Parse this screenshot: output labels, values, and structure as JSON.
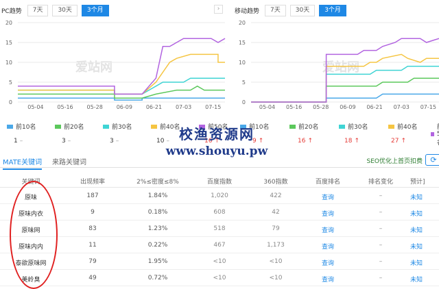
{
  "pc": {
    "title": "PC趋势",
    "tabs": [
      "7天",
      "30天",
      "3个月"
    ],
    "active": 2,
    "watermark": "爱站网"
  },
  "mobile": {
    "title": "移动趋势",
    "tabs": [
      "7天",
      "30天",
      "3个月"
    ],
    "active": 2,
    "watermark": "爱站网"
  },
  "colors": {
    "top10": "#4aa8e8",
    "top20": "#5cc85c",
    "top30": "#3fd4d4",
    "top40": "#f5c542",
    "top50": "#b264e0",
    "accent": "#1e88e5",
    "red": "#e53935"
  },
  "chart_data": [
    {
      "type": "line",
      "title": "PC趋势",
      "x": [
        "05-04",
        "05-16",
        "05-28",
        "06-09",
        "06-21",
        "07-03",
        "07-15"
      ],
      "ylim": [
        0,
        20
      ],
      "yticks": [
        0,
        5,
        10,
        15,
        20
      ],
      "grid": true,
      "series": [
        {
          "name": "前10名",
          "color": "#4aa8e8",
          "points": [
            [
              0,
              1
            ],
            [
              14,
              1
            ],
            [
              14,
              0.5
            ],
            [
              18,
              0.5
            ],
            [
              18,
              1
            ],
            [
              30,
              1
            ]
          ]
        },
        {
          "name": "前20名",
          "color": "#5cc85c",
          "points": [
            [
              0,
              2
            ],
            [
              14,
              2
            ],
            [
              14,
              1
            ],
            [
              18,
              1
            ],
            [
              20,
              2
            ],
            [
              23,
              3
            ],
            [
              25,
              3
            ],
            [
              26,
              4
            ],
            [
              27,
              3
            ],
            [
              30,
              3
            ]
          ]
        },
        {
          "name": "前30名",
          "color": "#3fd4d4",
          "points": [
            [
              0,
              3
            ],
            [
              14,
              3
            ],
            [
              14,
              2
            ],
            [
              18,
              2
            ],
            [
              20,
              4
            ],
            [
              21,
              5
            ],
            [
              24,
              5
            ],
            [
              25,
              6
            ],
            [
              26,
              6
            ],
            [
              27,
              6
            ],
            [
              30,
              6
            ]
          ]
        },
        {
          "name": "前40名",
          "color": "#f5c542",
          "points": [
            [
              0,
              3
            ],
            [
              14,
              3
            ],
            [
              14,
              2
            ],
            [
              18,
              2
            ],
            [
              20,
              5
            ],
            [
              22,
              10
            ],
            [
              23,
              11
            ],
            [
              25,
              12
            ],
            [
              29,
              12
            ],
            [
              29,
              10
            ],
            [
              30,
              10
            ]
          ]
        },
        {
          "name": "前50名",
          "color": "#b264e0",
          "points": [
            [
              0,
              4
            ],
            [
              14,
              4
            ],
            [
              14,
              2
            ],
            [
              18,
              2
            ],
            [
              20,
              6
            ],
            [
              21,
              14
            ],
            [
              22,
              14
            ],
            [
              23,
              15
            ],
            [
              24,
              16
            ],
            [
              28,
              16
            ],
            [
              29,
              15
            ],
            [
              30,
              16
            ]
          ]
        }
      ]
    },
    {
      "type": "line",
      "title": "移动趋势",
      "x": [
        "05-04",
        "05-16",
        "05-28",
        "06-09",
        "06-21",
        "07-03",
        "07-15"
      ],
      "ylim": [
        0,
        20
      ],
      "yticks": [
        0,
        5,
        10,
        15,
        20
      ],
      "grid": true,
      "series": [
        {
          "name": "前10名",
          "color": "#4aa8e8",
          "points": [
            [
              0,
              0
            ],
            [
              12,
              0
            ],
            [
              12,
              1
            ],
            [
              20,
              1
            ],
            [
              21,
              2
            ],
            [
              30,
              2
            ]
          ]
        },
        {
          "name": "前20名",
          "color": "#5cc85c",
          "points": [
            [
              0,
              0
            ],
            [
              12,
              0
            ],
            [
              12,
              4
            ],
            [
              20,
              4
            ],
            [
              21,
              5
            ],
            [
              25,
              5
            ],
            [
              26,
              6
            ],
            [
              30,
              6
            ]
          ]
        },
        {
          "name": "前30名",
          "color": "#3fd4d4",
          "points": [
            [
              0,
              0
            ],
            [
              12,
              0
            ],
            [
              12,
              7
            ],
            [
              19,
              7
            ],
            [
              20,
              8
            ],
            [
              24,
              8
            ],
            [
              25,
              9
            ],
            [
              30,
              9
            ]
          ]
        },
        {
          "name": "前40名",
          "color": "#f5c542",
          "points": [
            [
              0,
              0
            ],
            [
              12,
              0
            ],
            [
              12,
              9
            ],
            [
              18,
              9
            ],
            [
              19,
              10
            ],
            [
              20,
              10
            ],
            [
              21,
              11
            ],
            [
              24,
              12
            ],
            [
              25,
              11
            ],
            [
              27,
              10
            ],
            [
              28,
              11
            ],
            [
              30,
              11
            ]
          ]
        },
        {
          "name": "前50名",
          "color": "#b264e0",
          "points": [
            [
              0,
              0
            ],
            [
              12,
              0
            ],
            [
              12,
              12
            ],
            [
              17,
              12
            ],
            [
              18,
              13
            ],
            [
              20,
              13
            ],
            [
              21,
              14
            ],
            [
              23,
              15
            ],
            [
              24,
              16
            ],
            [
              26,
              16
            ],
            [
              27,
              16
            ],
            [
              28,
              15
            ],
            [
              30,
              16
            ]
          ]
        }
      ]
    }
  ],
  "legend": [
    {
      "label": "前10名",
      "color": "#4aa8e8"
    },
    {
      "label": "前20名",
      "color": "#5cc85c"
    },
    {
      "label": "前30名",
      "color": "#3fd4d4"
    },
    {
      "label": "前40名",
      "color": "#f5c542"
    },
    {
      "label": "前50名",
      "color": "#b264e0"
    }
  ],
  "pc_values": [
    {
      "value": "1",
      "arrow": "–"
    },
    {
      "value": "3",
      "arrow": "–"
    },
    {
      "value": "3",
      "arrow": "–"
    },
    {
      "value": "10",
      "arrow": "–"
    },
    {
      "value": "16",
      "arrow": "↑"
    }
  ],
  "mobile_values": [
    {
      "value": "9",
      "arrow": "↑"
    },
    {
      "value": "16",
      "arrow": "↑"
    },
    {
      "value": "18",
      "arrow": "↑"
    },
    {
      "value": "27",
      "arrow": "↑"
    },
    {
      "value": "",
      "arrow": ""
    }
  ],
  "watermark": {
    "line1": "校渔资源网",
    "line2": "www.shouyu.pw"
  },
  "keyword_tabs": {
    "active": "MATE关键词",
    "other": "来路关键词"
  },
  "seo_link": "SEO优化上首页扣费",
  "table": {
    "headers": [
      "关键词",
      "出现频率",
      "2%≤密度≤8%",
      "百度指数",
      "360指数",
      "百度排名",
      "排名变化",
      "预计]"
    ],
    "rows": [
      {
        "kw": "原味",
        "freq": "187",
        "density": "1.84%",
        "baidu": "1,020",
        "so360": "422",
        "rank": "查询",
        "change": "–",
        "est": "未知"
      },
      {
        "kw": "原味内衣",
        "freq": "9",
        "density": "0.18%",
        "baidu": "608",
        "so360": "42",
        "rank": "查询",
        "change": "–",
        "est": "未知"
      },
      {
        "kw": "原味网",
        "freq": "83",
        "density": "1.23%",
        "baidu": "518",
        "so360": "79",
        "rank": "查询",
        "change": "–",
        "est": "未知"
      },
      {
        "kw": "原味内内",
        "freq": "11",
        "density": "0.22%",
        "baidu": "467",
        "so360": "1,173",
        "rank": "查询",
        "change": "–",
        "est": "未知"
      },
      {
        "kw": "泰欲原味网",
        "freq": "79",
        "density": "1.95%",
        "baidu": "<10",
        "so360": "<10",
        "rank": "查询",
        "change": "–",
        "est": "未知"
      },
      {
        "kw": "美岭臭",
        "freq": "49",
        "density": "0.72%",
        "baidu": "<10",
        "so360": "<10",
        "rank": "查询",
        "change": "–",
        "est": "未知"
      }
    ]
  }
}
